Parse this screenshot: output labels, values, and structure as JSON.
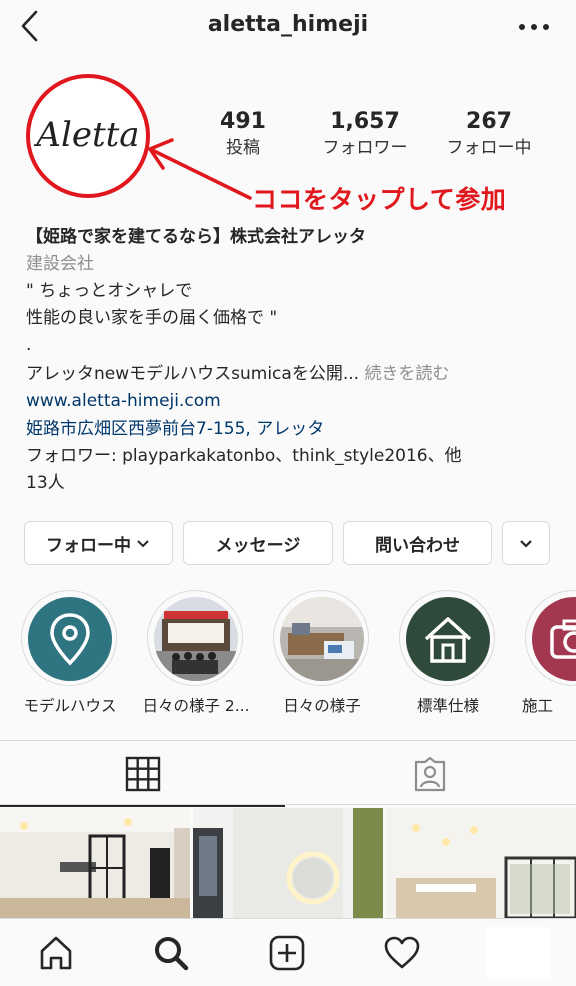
{
  "header": {
    "username": "aletta_himeji",
    "back_icon": "chevron-left-icon",
    "more_icon": "more-dots-icon"
  },
  "profile": {
    "avatar_text": "Aletta",
    "stats": [
      {
        "num": "491",
        "label": "投稿"
      },
      {
        "num": "1,657",
        "label": "フォロワー"
      },
      {
        "num": "267",
        "label": "フォロー中"
      }
    ],
    "annotation": "ココをタップして参加",
    "accent_color": "#e0181e"
  },
  "bio": {
    "name": "【姫路で家を建てるなら】株式会社アレッタ",
    "category": "建設会社",
    "line1": "\" ちょっとオシャレで",
    "line2": "性能の良い家を手の届く価格で \"",
    "line3": ".",
    "line4": "アレッタnewモデルハウスsumicaを公開...",
    "more": "続きを読む",
    "website": "www.aletta-himeji.com",
    "address": "姫路市広畑区西夢前台7-155, アレッタ",
    "followers_line1": "フォロワー: playparkakatonbo、think_style2016、他",
    "followers_line2": "13人"
  },
  "buttons": {
    "following": "フォロー中",
    "message": "メッセージ",
    "contact": "問い合わせ"
  },
  "highlights": [
    {
      "label": "モデルハウス",
      "icon": "location-pin-icon",
      "color": "#2e7481"
    },
    {
      "label": "日々の様子 2...",
      "icon": "photo"
    },
    {
      "label": "日々の様子",
      "icon": "photo"
    },
    {
      "label": "標準仕様",
      "icon": "house-icon",
      "color": "#2f4a3a"
    },
    {
      "label": "施工",
      "icon": "camera-icon",
      "color": "#a2374f"
    }
  ],
  "tabs": {
    "grid": "grid-icon",
    "tagged": "tagged-person-icon"
  },
  "bottom_nav": [
    "home-icon",
    "search-icon",
    "add-post-icon",
    "heart-icon",
    "profile-placeholder"
  ]
}
